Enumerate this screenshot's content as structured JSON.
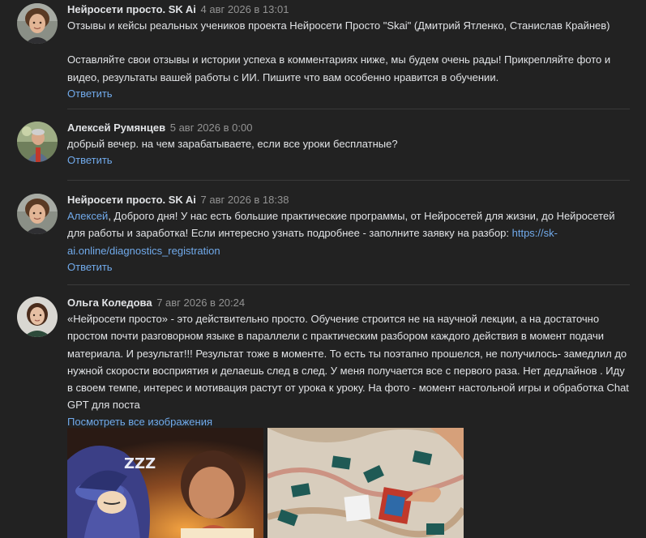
{
  "comments": [
    {
      "author": "Нейросети просто. SK Ai",
      "date": "4 авг 2026 в 13:01",
      "para1": "Отзывы и кейсы реальных учеников проекта Нейросети Просто \"Skai\" (Дмитрий Ятленко, Станислав Крайнев)",
      "para2": "Оставляйте свои отзывы и истории успеха в комментариях ниже, мы будем очень рады! Прикрепляйте фото и видео, результаты вашей работы с ИИ. Пишите что вам особенно нравится в обучении.",
      "reply": "Ответить"
    },
    {
      "author": "Алексей Румянцев",
      "date": "5 авг 2026 в 0:00",
      "text": "добрый вечер. на чем зарабатываете, если все уроки бесплатные?",
      "reply": "Ответить"
    },
    {
      "author": "Нейросети просто. SK Ai",
      "date": "7 авг 2026 в 18:38",
      "mention": "Алексей",
      "text": ", Доброго дня! У нас есть большие практические программы, от Нейросетей для жизни, до Нейросетей для работы и заработка! Если интересно узнать подробнее - заполните заявку на разбор: ",
      "link": "https://sk-ai.online/diagnostics_registration",
      "reply": "Ответить"
    },
    {
      "author": "Ольга Коледова",
      "date": "7 авг 2026 в 20:24",
      "text": "«Нейросети просто» - это действительно просто. Обучение строится не на научной лекции, а на достаточно простом почти разговорном языке в параллели с практическим разбором каждого действия в момент подачи материала. И результат!!! Результат тоже в моменте. То есть ты поэтапно прошелся, не получилось- замедлил до нужной скорости восприятия и делаешь след в след. У меня получается все с первого раза. Нет дедлайнов . Иду в своем темпе, интерес и мотивация растут от урока к уроку. На фото - момент настольной игры и обработка Chat GPT для поста",
      "view_all": "Посмотреть все изображения",
      "zzz": "ZZZ"
    }
  ],
  "colors": {
    "background": "#222222",
    "text": "#e1e3e6",
    "muted": "#939393",
    "link": "#71aaeb",
    "divider": "#3a3a3a"
  }
}
